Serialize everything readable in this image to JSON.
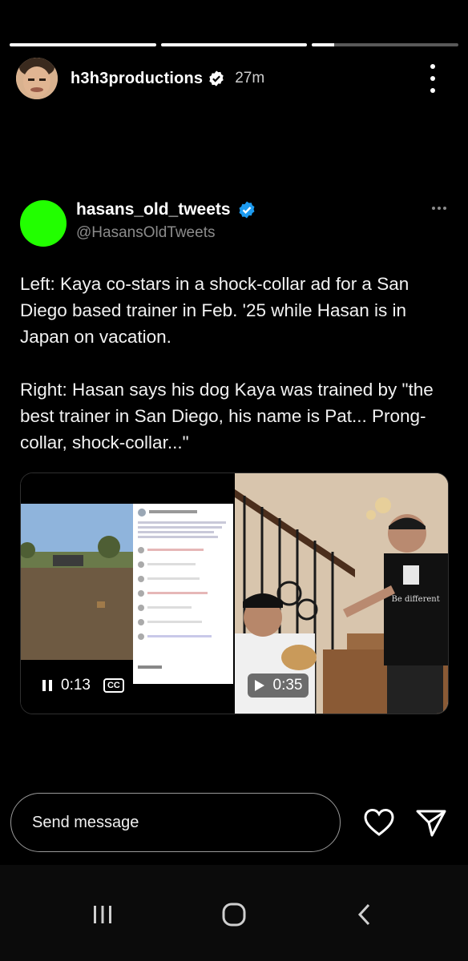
{
  "story": {
    "progress": [
      1.0,
      1.0,
      0.15
    ],
    "username": "h3h3productions",
    "time": "27m"
  },
  "tweet": {
    "display_name": "hasans_old_tweets",
    "handle": "@HasansOldTweets",
    "text": "Left: Kaya co-stars in a shock-collar ad for a San Diego based trainer in Feb. '25 while Hasan is in Japan on vacation.\n\nRight: Hasan says his dog Kaya was trained by \"the best trainer in San Diego, his name is Pat... Prong-collar, shock-collar...\"",
    "avatar_color": "#22ff00"
  },
  "media": {
    "left_video": {
      "time": "0:13",
      "cc_label": "CC",
      "state": "playing"
    },
    "right_video": {
      "time": "0:35",
      "state": "paused"
    },
    "shirt_text": "Be different"
  },
  "reply": {
    "placeholder": "Send message"
  },
  "icons": {
    "verified": "verified-badge-icon",
    "more": "more-vertical-icon",
    "heart": "heart-icon",
    "send": "send-icon"
  },
  "colors": {
    "verified_blue": "#1d9bf0",
    "handle_gray": "#8b8b8b"
  }
}
